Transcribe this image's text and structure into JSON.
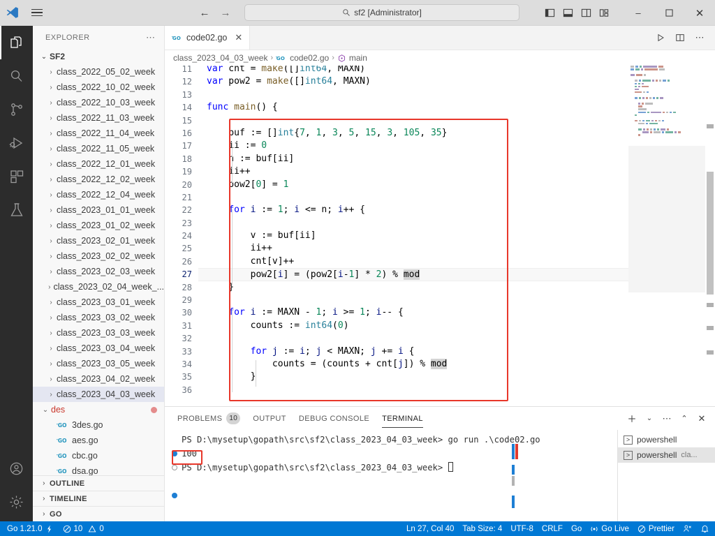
{
  "titlebar": {
    "search_text": "sf2 [Administrator]",
    "back_label": "←",
    "forward_label": "→",
    "minimize_label": "–",
    "maximize_label": "❐",
    "close_label": "✕",
    "layout_icons": [
      "toggle-primary-sidebar",
      "toggle-panel",
      "toggle-secondary-sidebar",
      "customize-layout"
    ]
  },
  "activitybar": {
    "items": [
      {
        "name": "explorer",
        "icon": "files-icon",
        "active": true
      },
      {
        "name": "search",
        "icon": "search-icon",
        "active": false
      },
      {
        "name": "source-control",
        "icon": "source-control-icon",
        "active": false
      },
      {
        "name": "run-and-debug",
        "icon": "run-debug-icon",
        "active": false
      },
      {
        "name": "extensions",
        "icon": "extensions-icon",
        "active": false
      },
      {
        "name": "testing",
        "icon": "beaker-icon",
        "active": false
      }
    ],
    "bottom": [
      {
        "name": "accounts",
        "icon": "account-icon"
      },
      {
        "name": "manage",
        "icon": "gear-icon"
      }
    ]
  },
  "sidebar": {
    "title": "EXPLORER",
    "more_label": "⋯",
    "root": "SF2",
    "folders": [
      "class_2022_05_02_week",
      "class_2022_10_02_week",
      "class_2022_10_03_week",
      "class_2022_11_03_week",
      "class_2022_11_04_week",
      "class_2022_11_05_week",
      "class_2022_12_01_week",
      "class_2022_12_02_week",
      "class_2022_12_04_week",
      "class_2023_01_01_week",
      "class_2023_01_02_week",
      "class_2023_02_01_week",
      "class_2023_02_02_week",
      "class_2023_02_03_week",
      "class_2023_02_04_week_...",
      "class_2023_03_01_week",
      "class_2023_03_02_week",
      "class_2023_03_03_week",
      "class_2023_03_04_week",
      "class_2023_03_05_week",
      "class_2023_04_02_week",
      "class_2023_04_03_week"
    ],
    "selected_folder": "class_2023_04_03_week",
    "expanded_folder": "des",
    "files": [
      "3des.go",
      "aes.go",
      "cbc.go",
      "dsa.go"
    ],
    "sections": [
      "OUTLINE",
      "TIMELINE",
      "GO"
    ]
  },
  "editor": {
    "tab": {
      "label": "code02.go",
      "close": "✕",
      "icon": "go-file-icon"
    },
    "actions": [
      "run-code-icon",
      "split-editor-icon",
      "more-actions-icon"
    ],
    "breadcrumbs": [
      {
        "label": "class_2023_04_03_week",
        "icon": null
      },
      {
        "label": "code02.go",
        "icon": "go-file-icon"
      },
      {
        "label": "main",
        "icon": "symbol-method-icon"
      }
    ],
    "first_line_number": 11,
    "current_line": 27,
    "lines": [
      {
        "n": 11,
        "text": "var cnt = make([]int64, MAXN)"
      },
      {
        "n": 12,
        "text": "var pow2 = make([]int64, MAXN)"
      },
      {
        "n": 13,
        "text": ""
      },
      {
        "n": 14,
        "text": "func main() {"
      },
      {
        "n": 15,
        "text": ""
      },
      {
        "n": 16,
        "text": "    buf := []int{7, 1, 3, 5, 15, 3, 105, 35}"
      },
      {
        "n": 17,
        "text": "    ii := 0"
      },
      {
        "n": 18,
        "text": "    n := buf[ii]"
      },
      {
        "n": 19,
        "text": "    ii++"
      },
      {
        "n": 20,
        "text": "    pow2[0] = 1"
      },
      {
        "n": 21,
        "text": ""
      },
      {
        "n": 22,
        "text": "    for i := 1; i <= n; i++ {"
      },
      {
        "n": 23,
        "text": ""
      },
      {
        "n": 24,
        "text": "        v := buf[ii]"
      },
      {
        "n": 25,
        "text": "        ii++"
      },
      {
        "n": 26,
        "text": "        cnt[v]++"
      },
      {
        "n": 27,
        "text": "        pow2[i] = (pow2[i-1] * 2) % mod"
      },
      {
        "n": 28,
        "text": "    }"
      },
      {
        "n": 29,
        "text": ""
      },
      {
        "n": 30,
        "text": "    for i := MAXN - 1; i >= 1; i-- {"
      },
      {
        "n": 31,
        "text": "        counts := int64(0)"
      },
      {
        "n": 32,
        "text": ""
      },
      {
        "n": 33,
        "text": "        for j := i; j < MAXN; j += i {"
      },
      {
        "n": 34,
        "text": "            counts = (counts + cnt[j]) % mod"
      },
      {
        "n": 35,
        "text": "        }"
      },
      {
        "n": 36,
        "text": ""
      }
    ]
  },
  "panel": {
    "tabs": [
      {
        "label": "PROBLEMS",
        "badge": "10",
        "active": false
      },
      {
        "label": "OUTPUT",
        "badge": null,
        "active": false
      },
      {
        "label": "DEBUG CONSOLE",
        "badge": null,
        "active": false
      },
      {
        "label": "TERMINAL",
        "badge": null,
        "active": true
      }
    ],
    "actions": [
      "new-terminal-icon",
      "chevron-down-icon",
      "more-actions-icon",
      "maximize-panel-icon",
      "close-panel-icon"
    ],
    "terminal": {
      "line1_prompt": "PS D:\\mysetup\\gopath\\src\\sf2\\class_2023_04_03_week>",
      "line1_cmd": " go run .\\code02.go",
      "output": "100",
      "line2_prompt": "PS D:\\mysetup\\gopath\\src\\sf2\\class_2023_04_03_week>"
    },
    "instances": [
      {
        "label": "powershell",
        "sub": "",
        "selected": false
      },
      {
        "label": "powershell",
        "sub": "cla...",
        "selected": true
      }
    ]
  },
  "statusbar": {
    "left": [
      {
        "name": "go-version",
        "label": "Go 1.21.0",
        "icon": "lightning-icon"
      },
      {
        "name": "problems",
        "label": "10",
        "icon": "error-icon",
        "label2": "0",
        "icon2": "warning-icon"
      }
    ],
    "go_version": "Go 1.21.0",
    "errors": "10",
    "warnings": "0",
    "position": "Ln 27, Col 40",
    "tab_size": "Tab Size: 4",
    "encoding": "UTF-8",
    "eol": "CRLF",
    "language": "Go",
    "golive": "Go Live",
    "prettier": "Prettier",
    "accent": "#0078d4"
  },
  "colors": {
    "keyword": "#0000ff",
    "type": "#267f99",
    "number": "#098658",
    "variable": "#001080",
    "highlight_box": "#e8372a",
    "selection": "#e4e6f1"
  }
}
